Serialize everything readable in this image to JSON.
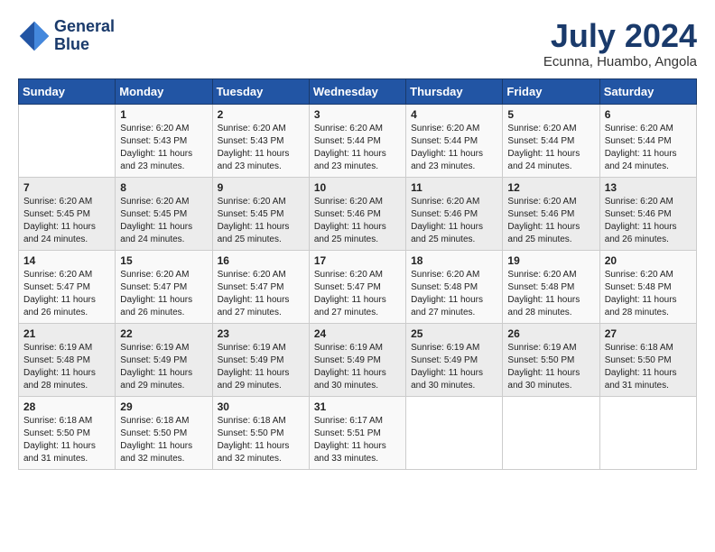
{
  "logo": {
    "line1": "General",
    "line2": "Blue"
  },
  "title": {
    "month_year": "July 2024",
    "location": "Ecunna, Huambo, Angola"
  },
  "days_of_week": [
    "Sunday",
    "Monday",
    "Tuesday",
    "Wednesday",
    "Thursday",
    "Friday",
    "Saturday"
  ],
  "weeks": [
    [
      {
        "day": "",
        "info": ""
      },
      {
        "day": "1",
        "info": "Sunrise: 6:20 AM\nSunset: 5:43 PM\nDaylight: 11 hours\nand 23 minutes."
      },
      {
        "day": "2",
        "info": "Sunrise: 6:20 AM\nSunset: 5:43 PM\nDaylight: 11 hours\nand 23 minutes."
      },
      {
        "day": "3",
        "info": "Sunrise: 6:20 AM\nSunset: 5:44 PM\nDaylight: 11 hours\nand 23 minutes."
      },
      {
        "day": "4",
        "info": "Sunrise: 6:20 AM\nSunset: 5:44 PM\nDaylight: 11 hours\nand 23 minutes."
      },
      {
        "day": "5",
        "info": "Sunrise: 6:20 AM\nSunset: 5:44 PM\nDaylight: 11 hours\nand 24 minutes."
      },
      {
        "day": "6",
        "info": "Sunrise: 6:20 AM\nSunset: 5:44 PM\nDaylight: 11 hours\nand 24 minutes."
      }
    ],
    [
      {
        "day": "7",
        "info": "Sunrise: 6:20 AM\nSunset: 5:45 PM\nDaylight: 11 hours\nand 24 minutes."
      },
      {
        "day": "8",
        "info": "Sunrise: 6:20 AM\nSunset: 5:45 PM\nDaylight: 11 hours\nand 24 minutes."
      },
      {
        "day": "9",
        "info": "Sunrise: 6:20 AM\nSunset: 5:45 PM\nDaylight: 11 hours\nand 25 minutes."
      },
      {
        "day": "10",
        "info": "Sunrise: 6:20 AM\nSunset: 5:46 PM\nDaylight: 11 hours\nand 25 minutes."
      },
      {
        "day": "11",
        "info": "Sunrise: 6:20 AM\nSunset: 5:46 PM\nDaylight: 11 hours\nand 25 minutes."
      },
      {
        "day": "12",
        "info": "Sunrise: 6:20 AM\nSunset: 5:46 PM\nDaylight: 11 hours\nand 25 minutes."
      },
      {
        "day": "13",
        "info": "Sunrise: 6:20 AM\nSunset: 5:46 PM\nDaylight: 11 hours\nand 26 minutes."
      }
    ],
    [
      {
        "day": "14",
        "info": "Sunrise: 6:20 AM\nSunset: 5:47 PM\nDaylight: 11 hours\nand 26 minutes."
      },
      {
        "day": "15",
        "info": "Sunrise: 6:20 AM\nSunset: 5:47 PM\nDaylight: 11 hours\nand 26 minutes."
      },
      {
        "day": "16",
        "info": "Sunrise: 6:20 AM\nSunset: 5:47 PM\nDaylight: 11 hours\nand 27 minutes."
      },
      {
        "day": "17",
        "info": "Sunrise: 6:20 AM\nSunset: 5:47 PM\nDaylight: 11 hours\nand 27 minutes."
      },
      {
        "day": "18",
        "info": "Sunrise: 6:20 AM\nSunset: 5:48 PM\nDaylight: 11 hours\nand 27 minutes."
      },
      {
        "day": "19",
        "info": "Sunrise: 6:20 AM\nSunset: 5:48 PM\nDaylight: 11 hours\nand 28 minutes."
      },
      {
        "day": "20",
        "info": "Sunrise: 6:20 AM\nSunset: 5:48 PM\nDaylight: 11 hours\nand 28 minutes."
      }
    ],
    [
      {
        "day": "21",
        "info": "Sunrise: 6:19 AM\nSunset: 5:48 PM\nDaylight: 11 hours\nand 28 minutes."
      },
      {
        "day": "22",
        "info": "Sunrise: 6:19 AM\nSunset: 5:49 PM\nDaylight: 11 hours\nand 29 minutes."
      },
      {
        "day": "23",
        "info": "Sunrise: 6:19 AM\nSunset: 5:49 PM\nDaylight: 11 hours\nand 29 minutes."
      },
      {
        "day": "24",
        "info": "Sunrise: 6:19 AM\nSunset: 5:49 PM\nDaylight: 11 hours\nand 30 minutes."
      },
      {
        "day": "25",
        "info": "Sunrise: 6:19 AM\nSunset: 5:49 PM\nDaylight: 11 hours\nand 30 minutes."
      },
      {
        "day": "26",
        "info": "Sunrise: 6:19 AM\nSunset: 5:50 PM\nDaylight: 11 hours\nand 30 minutes."
      },
      {
        "day": "27",
        "info": "Sunrise: 6:18 AM\nSunset: 5:50 PM\nDaylight: 11 hours\nand 31 minutes."
      }
    ],
    [
      {
        "day": "28",
        "info": "Sunrise: 6:18 AM\nSunset: 5:50 PM\nDaylight: 11 hours\nand 31 minutes."
      },
      {
        "day": "29",
        "info": "Sunrise: 6:18 AM\nSunset: 5:50 PM\nDaylight: 11 hours\nand 32 minutes."
      },
      {
        "day": "30",
        "info": "Sunrise: 6:18 AM\nSunset: 5:50 PM\nDaylight: 11 hours\nand 32 minutes."
      },
      {
        "day": "31",
        "info": "Sunrise: 6:17 AM\nSunset: 5:51 PM\nDaylight: 11 hours\nand 33 minutes."
      },
      {
        "day": "",
        "info": ""
      },
      {
        "day": "",
        "info": ""
      },
      {
        "day": "",
        "info": ""
      }
    ]
  ]
}
